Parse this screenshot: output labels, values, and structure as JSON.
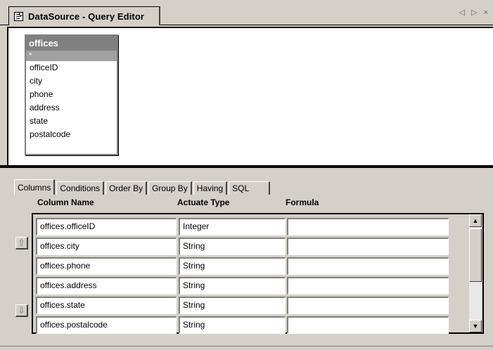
{
  "window": {
    "title": "DataSource - Query Editor",
    "nav_arrows": "◁ ▷ ×"
  },
  "diagram": {
    "table": {
      "name": "offices",
      "star_field": "*",
      "fields": [
        "officeID",
        "city",
        "phone",
        "address",
        "state",
        "postalcode"
      ]
    }
  },
  "tabs": [
    {
      "label": "Columns",
      "active": true
    },
    {
      "label": "Conditions",
      "active": false
    },
    {
      "label": "Order By",
      "active": false
    },
    {
      "label": "Group By",
      "active": false
    },
    {
      "label": "Having",
      "active": false
    },
    {
      "label": "SQL",
      "active": false
    }
  ],
  "grid": {
    "headers": {
      "column_name": "Column Name",
      "actuate_type": "Actuate Type",
      "formula": "Formula"
    },
    "rows": [
      {
        "column_name": "offices.officeID",
        "actuate_type": "Integer",
        "formula": ""
      },
      {
        "column_name": "offices.city",
        "actuate_type": "String",
        "formula": ""
      },
      {
        "column_name": "offices.phone",
        "actuate_type": "String",
        "formula": ""
      },
      {
        "column_name": "offices.address",
        "actuate_type": "String",
        "formula": ""
      },
      {
        "column_name": "offices.state",
        "actuate_type": "String",
        "formula": ""
      },
      {
        "column_name": "offices.postalcode",
        "actuate_type": "String",
        "formula": ""
      }
    ]
  },
  "icons": {
    "document": "query-document-icon",
    "move_up": "arrow-up-icon",
    "move_down": "arrow-down-icon",
    "scroll_up": "scroll-up-arrow-icon",
    "scroll_down": "scroll-down-arrow-icon"
  }
}
